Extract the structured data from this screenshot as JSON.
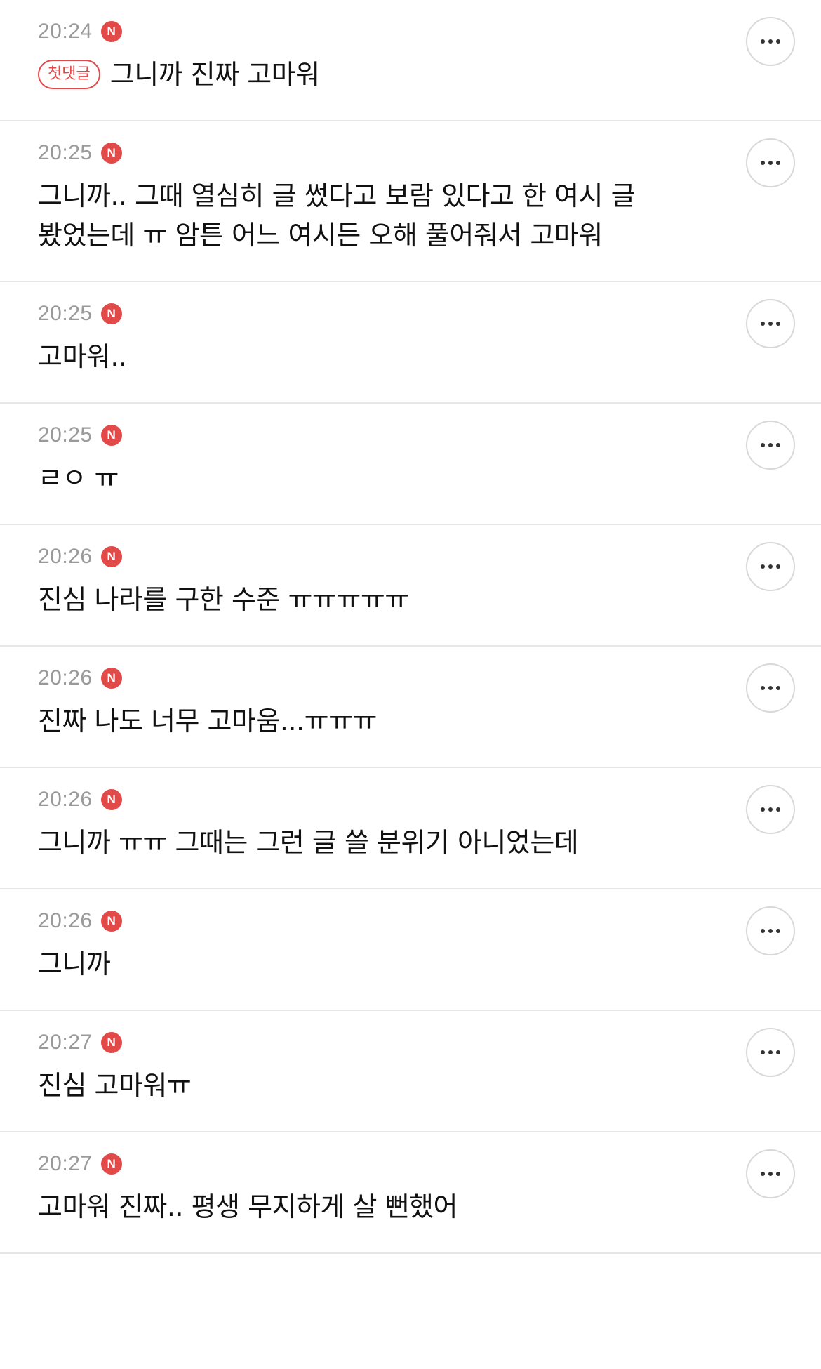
{
  "comments": [
    {
      "time": "20:24",
      "new_badge": "N",
      "first_badge": "첫댓글",
      "text": "그니까 진짜 고마워"
    },
    {
      "time": "20:25",
      "new_badge": "N",
      "text": "그니까.. 그때 열심히 글 썼다고 보람 있다고 한 여시 글 봤었는데 ㅠ 암튼 어느 여시든 오해 풀어줘서 고마워"
    },
    {
      "time": "20:25",
      "new_badge": "N",
      "text": "고마워.."
    },
    {
      "time": "20:25",
      "new_badge": "N",
      "text": "ㄹㅇ ㅠ"
    },
    {
      "time": "20:26",
      "new_badge": "N",
      "text": "진심 나라를 구한 수준 ㅠㅠㅠㅠㅠ"
    },
    {
      "time": "20:26",
      "new_badge": "N",
      "text": "진짜 나도 너무 고마움...ㅠㅠㅠ"
    },
    {
      "time": "20:26",
      "new_badge": "N",
      "text": "그니까 ㅠㅠ 그때는 그런 글 쓸 분위기 아니었는데"
    },
    {
      "time": "20:26",
      "new_badge": "N",
      "text": "그니까"
    },
    {
      "time": "20:27",
      "new_badge": "N",
      "text": "진심 고마워ㅠ"
    },
    {
      "time": "20:27",
      "new_badge": "N",
      "text": "고마워 진짜.. 평생 무지하게 살 뻔했어"
    }
  ],
  "icons": {
    "more": "more-horizontal-icon"
  },
  "colors": {
    "accent": "#e24a4a",
    "time": "#9a9a9a",
    "text": "#111111",
    "divider": "#e6e6e6"
  }
}
